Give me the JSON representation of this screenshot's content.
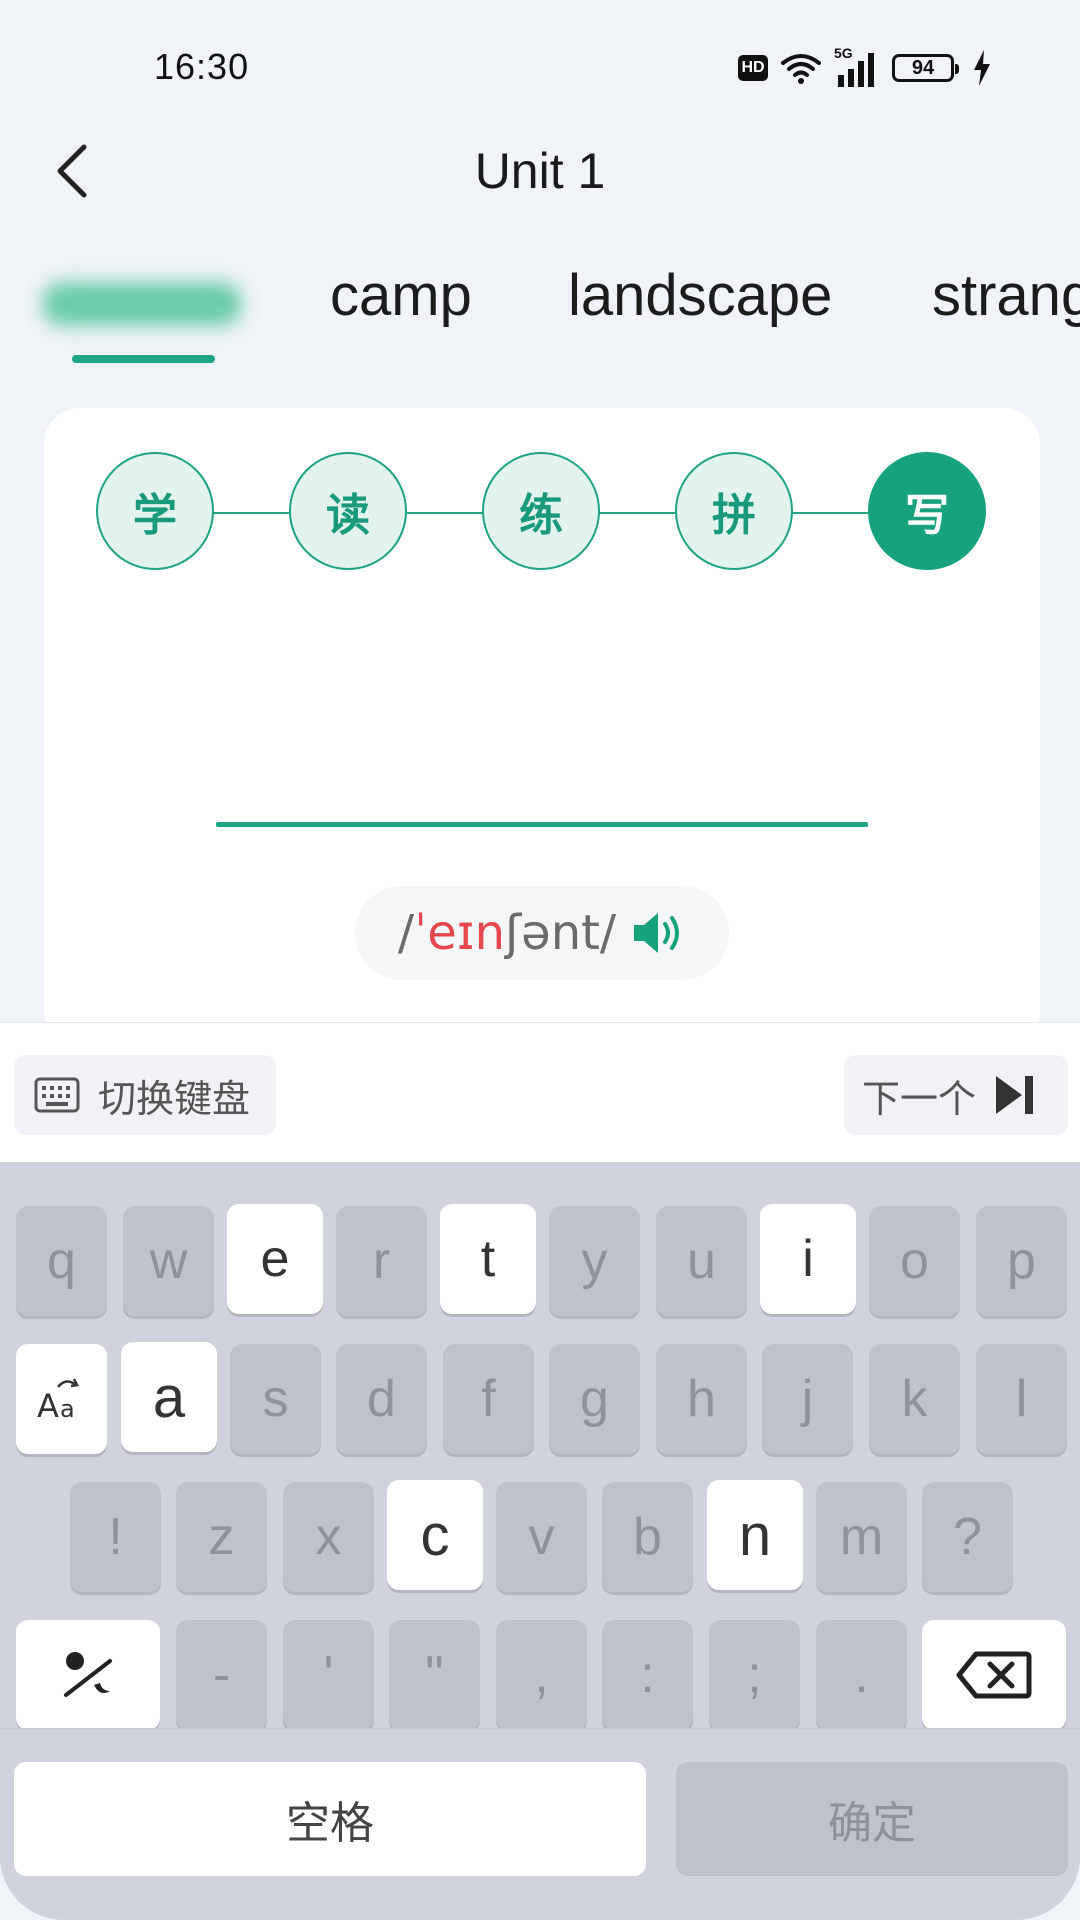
{
  "status_bar": {
    "time": "16:30",
    "hd": "HD",
    "network": "5G",
    "battery": "94"
  },
  "header": {
    "title": "Unit 1"
  },
  "word_tabs": [
    {
      "label": "",
      "selected": true,
      "blurred": true
    },
    {
      "label": "camp"
    },
    {
      "label": "landscape"
    },
    {
      "label": "strang"
    }
  ],
  "steps": [
    {
      "label": "学"
    },
    {
      "label": "读"
    },
    {
      "label": "练"
    },
    {
      "label": "拼"
    },
    {
      "label": "写",
      "active": true
    }
  ],
  "phonetic": {
    "prefix": "/",
    "highlight": "ˈeɪn",
    "suffix": "ʃənt/"
  },
  "toolbar": {
    "switch_keyboard": "切换键盘",
    "next": "下一个"
  },
  "keyboard": {
    "row1": [
      "q",
      "w",
      "e",
      "r",
      "t",
      "y",
      "u",
      "i",
      "o",
      "p"
    ],
    "row2": [
      "a",
      "s",
      "d",
      "f",
      "g",
      "h",
      "j",
      "k",
      "l"
    ],
    "row3": [
      "!",
      "z",
      "x",
      "c",
      "v",
      "b",
      "n",
      "m",
      "?"
    ],
    "row4": [
      "-",
      "'",
      "\"",
      ",",
      ":",
      ";",
      "."
    ],
    "lit_keys": [
      "e",
      "t",
      "i",
      "a",
      "c",
      "n"
    ],
    "space": "空格",
    "confirm": "确定"
  },
  "colors": {
    "accent": "#1ea485",
    "highlight": "#e4484d",
    "background": "#f0f3f7"
  }
}
